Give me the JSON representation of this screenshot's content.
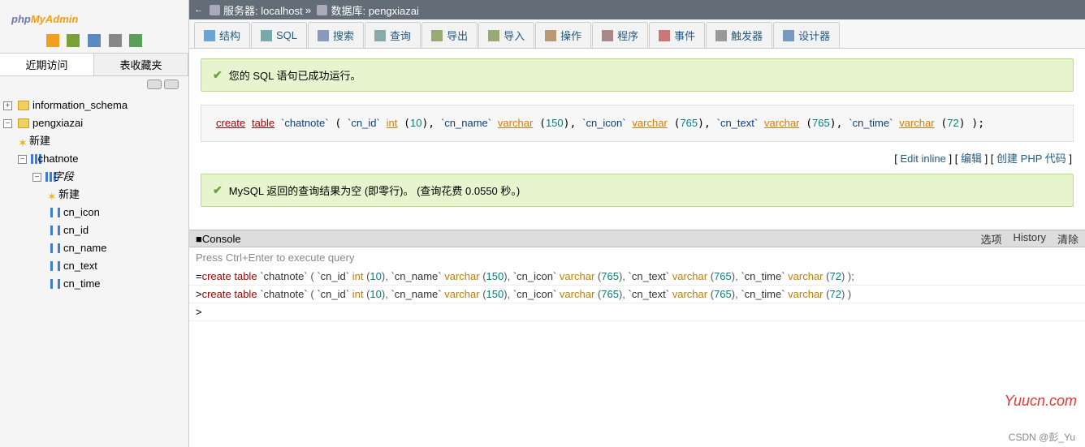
{
  "logo": {
    "a": "php",
    "b": "MyAdmin"
  },
  "sidebar": {
    "tabs": [
      "近期访问",
      "表收藏夹"
    ],
    "dbs": [
      "information_schema",
      "pengxiazai"
    ],
    "new": "新建",
    "table": "chatnote",
    "cols_label": "字段",
    "cols": [
      "cn_icon",
      "cn_id",
      "cn_name",
      "cn_text",
      "cn_time"
    ]
  },
  "bc": {
    "server_lbl": "服务器:",
    "server": "localhost",
    "db_lbl": "数据库:",
    "db": "pengxiazai",
    "sep": "»"
  },
  "mtabs": [
    "结构",
    "SQL",
    "搜索",
    "查询",
    "导出",
    "导入",
    "操作",
    "程序",
    "事件",
    "触发器",
    "设计器"
  ],
  "msg1": "您的 SQL 语句已成功运行。",
  "msg2": "MySQL 返回的查询结果为空 (即零行)。 (查询花费 0.0550 秒。)",
  "actions": {
    "edit_inline": "Edit inline",
    "edit": "编辑",
    "php": "创建 PHP 代码"
  },
  "console": {
    "title": "Console",
    "opts": "选项",
    "hist": "History",
    "clear": "清除",
    "hint": "Press Ctrl+Enter to execute query"
  },
  "wm": "Yuucn.com",
  "footer": "CSDN @彭_Yu",
  "chart_data": {
    "type": "table",
    "title": "create table chatnote",
    "columns": [
      {
        "name": "cn_id",
        "type": "int",
        "length": 10
      },
      {
        "name": "cn_name",
        "type": "varchar",
        "length": 150
      },
      {
        "name": "cn_icon",
        "type": "varchar",
        "length": 765
      },
      {
        "name": "cn_text",
        "type": "varchar",
        "length": 765
      },
      {
        "name": "cn_time",
        "type": "varchar",
        "length": 72
      }
    ]
  }
}
